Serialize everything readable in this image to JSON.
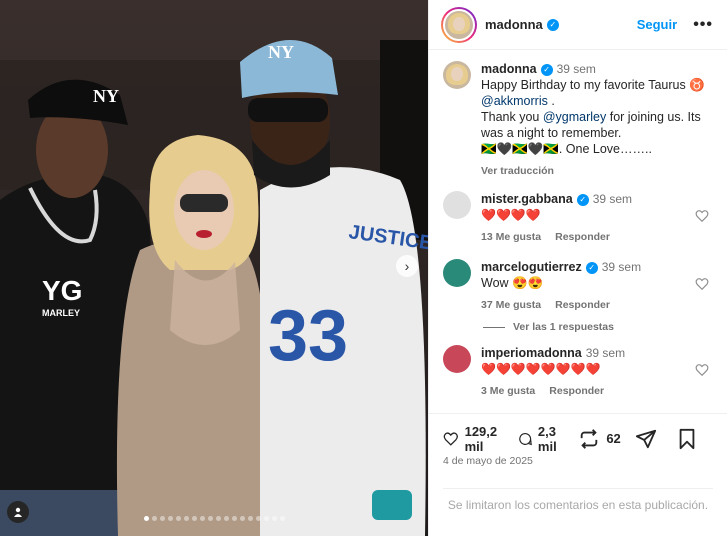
{
  "post": {
    "author": "madonna",
    "follow_label": "Seguir",
    "more_label": "•••",
    "caption": {
      "username": "madonna",
      "time": "39 sem",
      "line1": "Happy Birthday  to my favorite Taurus ♉",
      "mention1": "@akkmorris",
      "line2_pre": "Thank you ",
      "mention2": "@ygmarley",
      "line2_post": " for joining us.  Its was a night to remember.",
      "line3": "🇯🇲🖤🇯🇲🖤🇯🇲. One Love……..",
      "translate": "Ver traducción"
    },
    "comments": [
      {
        "username": "mister.gabbana",
        "time": "39 sem",
        "text": "❤️❤️❤️❤️",
        "likes": "13 Me gusta",
        "reply": "Responder",
        "verified": true
      },
      {
        "username": "marcelogutierrez",
        "time": "39 sem",
        "text": "Wow 😍😍",
        "likes": "37 Me gusta",
        "reply": "Responder",
        "verified": true
      },
      {
        "username": "imperiomadonna",
        "time": "39 sem",
        "text": "❤️❤️❤️❤️❤️❤️❤️❤️",
        "likes": "3 Me gusta",
        "reply": "Responder",
        "verified": false
      }
    ],
    "view_replies": "Ver las 1 respuestas",
    "likes_count": "129,2 mil",
    "comments_count": "2,3 mil",
    "reposts_count": "62",
    "date": "4 de mayo de 2025",
    "comments_limited": "Se limitaron los comentarios en esta publicación.",
    "media": {
      "carousel_count": 18,
      "active_index": 0,
      "cap_text_1": "NY",
      "cap_text_2": "NY",
      "shirt_text": "YG",
      "shirt_text_sub": "MARLEY",
      "jersey_text": "JUSTICE",
      "jersey_number": "33"
    }
  }
}
